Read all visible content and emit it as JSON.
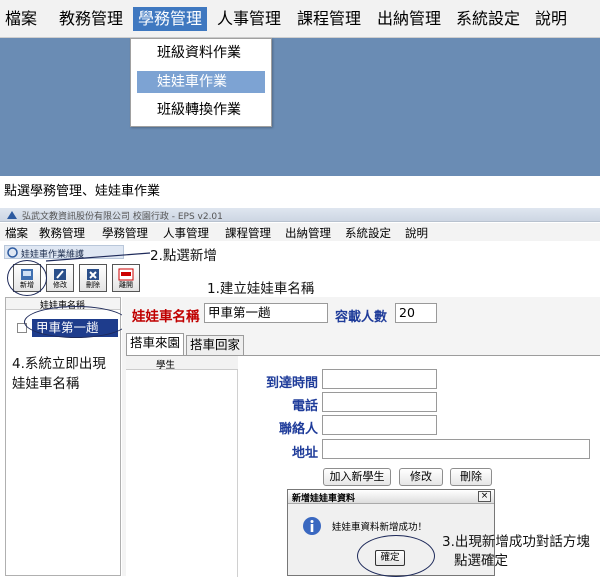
{
  "top_screen": {
    "menu": [
      "檔案",
      "教務管理",
      "學務管理",
      "人事管理",
      "課程管理",
      "出納管理",
      "系統設定",
      "說明"
    ],
    "dropdown": [
      "班級資料作業",
      "娃娃車作業",
      "班級轉換作業"
    ]
  },
  "caption": "點選學務管理、娃娃車作業",
  "window": {
    "title": "弘武文教資訊股份有限公司 校園行政 - EPS v2.01",
    "menu": [
      "檔案",
      "教務管理",
      "學務管理",
      "人事管理",
      "課程管理",
      "出納管理",
      "系統設定",
      "說明"
    ],
    "subwindow_title": "娃娃車作業維護",
    "toolbar": [
      "新增",
      "修改",
      "刪除",
      "離開"
    ],
    "list_header": "娃娃車名稱",
    "list_items": [
      "甲車第一趟"
    ],
    "form": {
      "name_label": "娃娃車名稱",
      "name_value": "甲車第一趟",
      "capacity_label": "容載人數",
      "capacity_value": "20"
    },
    "tabs": [
      "搭車來園",
      "搭車回家"
    ],
    "student_header": "學生",
    "fields": [
      "到達時間",
      "電話",
      "聯絡人",
      "地址"
    ],
    "buttons": [
      "加入新學生",
      "修改",
      "刪除"
    ],
    "dialog": {
      "title": "新增娃娃車資料",
      "message": "娃娃車資料新增成功！",
      "ok": "確定",
      "close": "×"
    }
  },
  "annotations": {
    "a1": "1.建立娃娃車名稱",
    "a2": "2.點選新增",
    "a3_line1": "3.出現新增成功對話方塊",
    "a3_line2": "點選確定",
    "a4_line1": "4.系統立即出現",
    "a4_line2": "娃娃車名稱"
  }
}
